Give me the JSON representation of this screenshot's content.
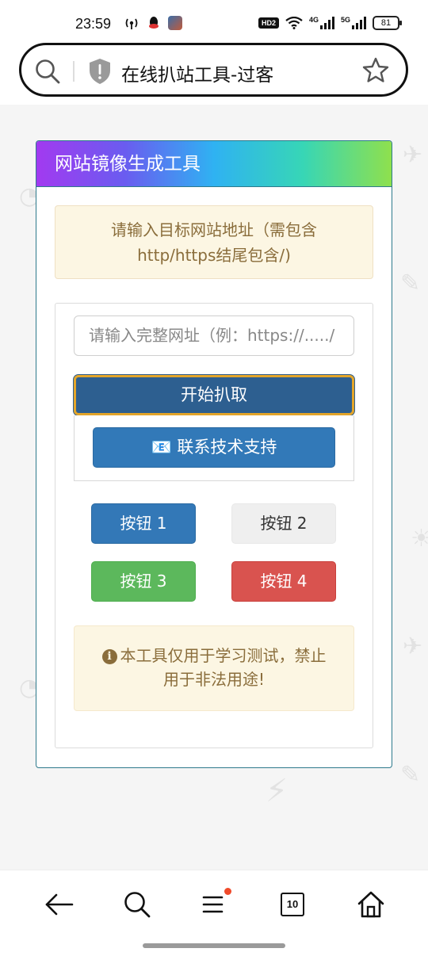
{
  "status_bar": {
    "time": "23:59",
    "network_labels": [
      "4G",
      "5G"
    ],
    "hd_label": "HD2",
    "battery": "81"
  },
  "browser": {
    "address_text": "在线扒站工具-过客",
    "icons": [
      "search-icon",
      "shield-icon",
      "star-icon"
    ]
  },
  "page": {
    "card_title": "网站镜像生成工具",
    "notice": [
      "请输入目标网站地址（需包含",
      "http/https结尾包含/)"
    ],
    "url_input": {
      "placeholder": "请输入完整网址（例：https://...../",
      "value": ""
    },
    "start_button": "开始扒取",
    "support_button": "📧 联系技术支持",
    "buttons": [
      "按钮 1",
      "按钮 2",
      "按钮 3",
      "按钮 4"
    ],
    "warning": [
      "本工具仅用于学习测试，禁止",
      "用于非法用途!"
    ],
    "warning_icon": "i"
  },
  "bottom_nav": {
    "tabs_count": "10",
    "items": [
      "back-arrow-icon",
      "search-icon",
      "menu-icon",
      "tabs-icon",
      "home-icon"
    ]
  },
  "colors": {
    "primary": "#3378b7",
    "start_button": "#2d5f90",
    "success": "#5cb85c",
    "danger": "#d9534f",
    "warning_bg": "#fcf6e3",
    "warning_text": "#8a6d3b"
  }
}
